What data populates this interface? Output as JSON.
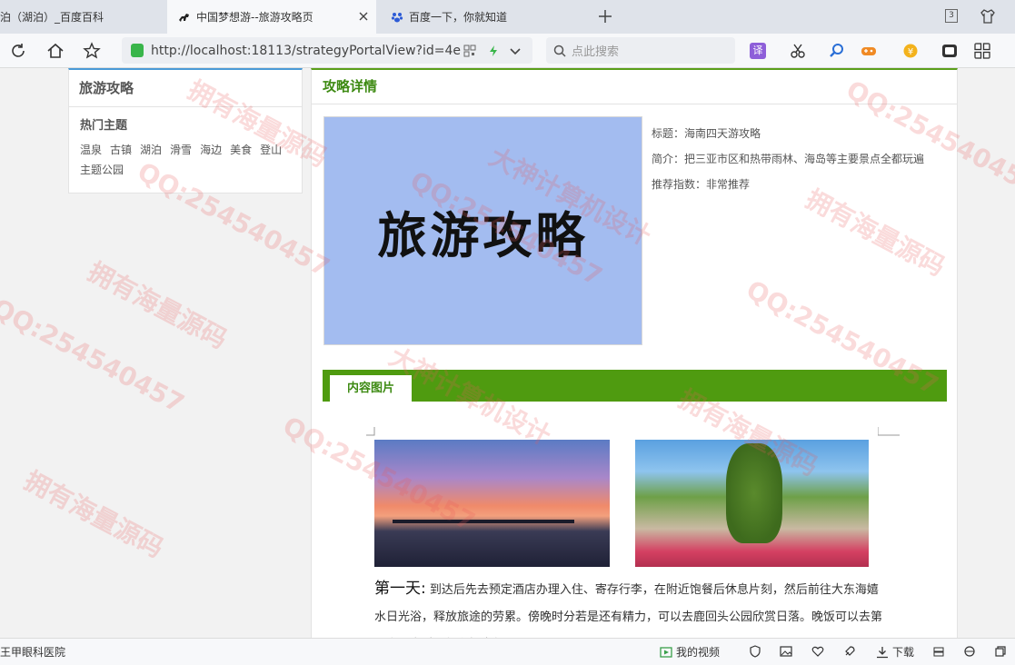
{
  "browser": {
    "tabs": [
      {
        "label": "泊（湖泊）_百度百科",
        "active": false
      },
      {
        "label": "中国梦想游--旅游攻略页",
        "active": true
      },
      {
        "label": "百度一下，你就知道",
        "active": false
      }
    ],
    "tab_count_badge": "3",
    "url": "http://localhost:18113/strategyPortalView?id=4e",
    "search_placeholder": "点此搜索",
    "ext_translate": "译"
  },
  "sidebar": {
    "title": "旅游攻略",
    "hot_title": "热门主题",
    "hot_items": [
      "温泉",
      "古镇",
      "湖泊",
      "滑雪",
      "海边",
      "美食",
      "登山",
      "主题公园"
    ]
  },
  "main": {
    "title": "攻略详情",
    "cover_text": "旅游攻略",
    "info": {
      "title_line": "标题：海南四天游攻略",
      "intro_line": "简介：把三亚市区和热带雨林、海岛等主要景点全都玩遍",
      "rating_line": "推荐指数：非常推荐"
    },
    "content_tab": "内容图片",
    "article": {
      "day": "第一天",
      "colon": ":",
      "text": "到达后先去预定酒店办理入住、寄存行李，在附近饱餐后休息片刻，然后前往大东海嬉水日光浴，释放旅途的劳累。傍晚时分若是还有精力，可以去鹿回头公园欣赏日落。晚饭可以去第一市场享受一顿海鲜大餐。↵"
    }
  },
  "statusbar": {
    "left_text": "王甲眼科医院",
    "video_label": "我的视频",
    "download_label": "下载"
  },
  "watermarks": {
    "qq": "QQ:254540457",
    "source": "拥有海量源码",
    "design": "大神计算机设计"
  },
  "colors": {
    "accent_green": "#4f9b10",
    "title_green": "#3d8a12",
    "sidebar_blue": "#4a9ad6",
    "cover_bg": "#a3bcf0"
  }
}
